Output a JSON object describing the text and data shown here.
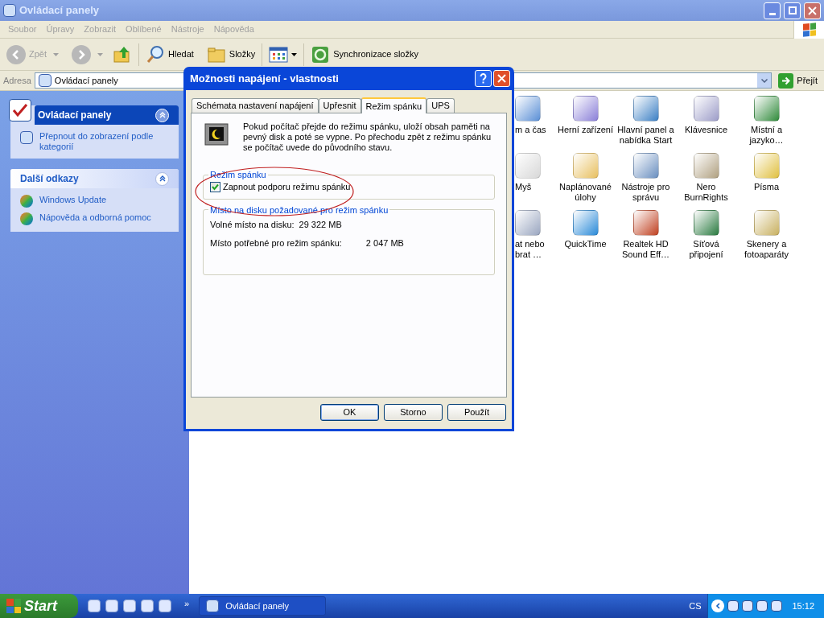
{
  "window": {
    "title": "Ovládací panely",
    "active": false
  },
  "menu": [
    "Soubor",
    "Úpravy",
    "Zobrazit",
    "Oblíbené",
    "Nástroje",
    "Nápověda"
  ],
  "toolbar": {
    "back": {
      "label": "Zpět",
      "disabled": true
    },
    "search": "Hledat",
    "folders": "Složky",
    "sync": "Synchronizace složky"
  },
  "address": {
    "label": "Adresa",
    "value": "Ovládací panely",
    "go": "Přejít"
  },
  "sidebar": [
    {
      "title": "Ovládací panely",
      "primary": true,
      "links": [
        "Přepnout do zobrazení podle kategorií"
      ]
    },
    {
      "title": "Další odkazy",
      "primary": false,
      "links": [
        "Windows Update",
        "Nápověda a odborná pomoc"
      ]
    }
  ],
  "items": [
    {
      "label": "m a čas"
    },
    {
      "label": "Herní zařízení"
    },
    {
      "label": "Hlavní panel a nabídka Start"
    },
    {
      "label": "Klávesnice"
    },
    {
      "label": "Místní a jazyko…"
    },
    {
      "label": "Myš"
    },
    {
      "label": "Naplánované úlohy"
    },
    {
      "label": "Nástroje pro správu"
    },
    {
      "label": "Nero BurnRights"
    },
    {
      "label": "Písma"
    },
    {
      "label": "at nebo brat …"
    },
    {
      "label": "QuickTime"
    },
    {
      "label": "Realtek HD Sound Eff…"
    },
    {
      "label": "Síťová připojení"
    },
    {
      "label": "Skenery a fotoaparáty"
    }
  ],
  "dialog": {
    "title": "Možnosti napájení - vlastnosti",
    "tabs": [
      {
        "label": "Schémata nastavení napájení",
        "selected": false
      },
      {
        "label": "Upřesnit",
        "selected": false
      },
      {
        "label": "Režim spánku",
        "selected": true
      },
      {
        "label": "UPS",
        "selected": false
      }
    ],
    "description": "Pokud počítač přejde do režimu spánku, uloží obsah paměti na pevný disk a poté se vypne. Po přechodu zpět z režimu spánku se počítač uvede do původního stavu.",
    "hibernate_group": {
      "title": "Režim spánku",
      "checkbox": {
        "label": "Zapnout podporu režimu spánku",
        "checked": true
      }
    },
    "disk_group": {
      "title": "Místo na disku požadované pro režim spánku",
      "rows": [
        {
          "label": "Volné místo na disku:",
          "value": "29 322 MB"
        },
        {
          "label": "Místo potřebné pro režim spánku:",
          "value": "2 047 MB"
        }
      ]
    },
    "buttons": [
      {
        "label": "OK",
        "default": true
      },
      {
        "label": "Storno",
        "default": false
      },
      {
        "label": "Použít",
        "default": false
      }
    ]
  },
  "taskbar": {
    "start": "Start",
    "chevron": "»",
    "task": "Ovládací panely",
    "language": "CS",
    "clock": "15:12"
  }
}
